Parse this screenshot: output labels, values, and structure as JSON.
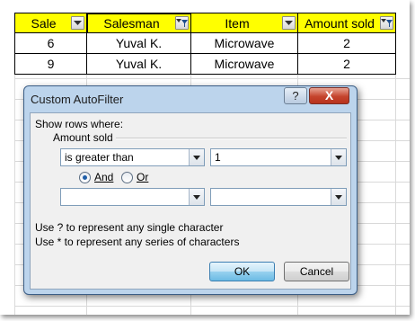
{
  "sheet": {
    "columns": [
      {
        "label": "Sale",
        "filter_active": false
      },
      {
        "label": "Salesman",
        "filter_active": true
      },
      {
        "label": "Item",
        "filter_active": false
      },
      {
        "label": "Amount sold",
        "filter_active": true
      }
    ],
    "rows": [
      [
        "6",
        "Yuval K.",
        "Microwave",
        "2"
      ],
      [
        "9",
        "Yuval K.",
        "Microwave",
        "2"
      ]
    ]
  },
  "dialog": {
    "title": "Custom AutoFilter",
    "help_label": "?",
    "close_label": "X",
    "show_rows_label": "Show rows where:",
    "field_label": "Amount sold",
    "condition1": {
      "operator": "is greater than",
      "value": "1"
    },
    "condition2": {
      "operator": "",
      "value": ""
    },
    "logic": {
      "and_label": "And",
      "or_label": "Or",
      "selected": "And"
    },
    "hint_single": "Use ? to represent any single character",
    "hint_series": "Use * to represent any series of characters",
    "ok_label": "OK",
    "cancel_label": "Cancel"
  },
  "colors": {
    "header_fill": "#ffff00",
    "dialog_frame": "#bcd4ec",
    "close_button": "#c5442d"
  }
}
